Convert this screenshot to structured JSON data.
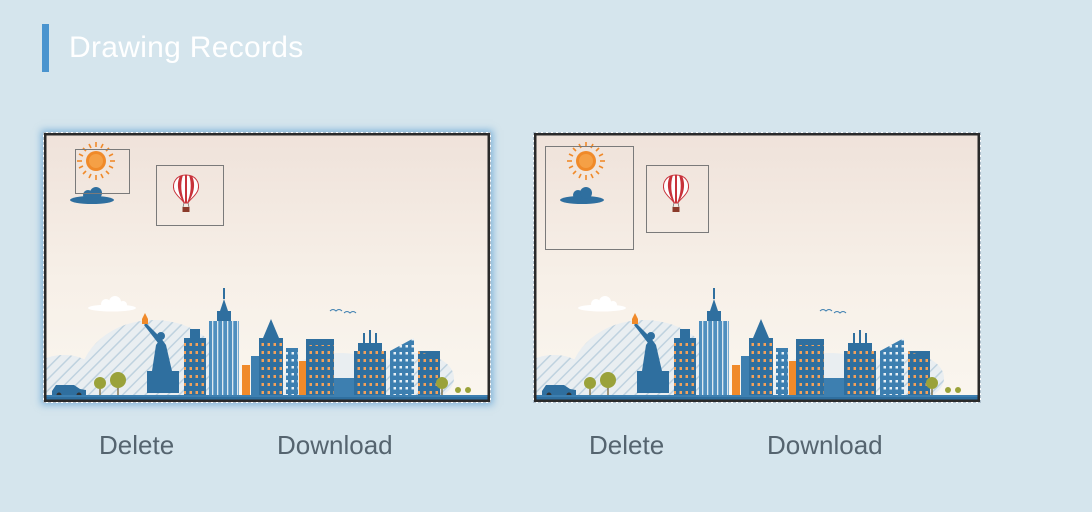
{
  "header": {
    "title": "Drawing Records"
  },
  "records": [
    {
      "delete_label": "Delete",
      "download_label": "Download"
    },
    {
      "delete_label": "Delete",
      "download_label": "Download"
    }
  ],
  "colors": {
    "accent": "#4a94cf",
    "background": "#d5e5ed",
    "action_text": "#55646f",
    "building_blue": "#2f6f9f",
    "sun_orange": "#f08a2a",
    "balloon_red": "#c8323a"
  },
  "icons": {
    "sun": "sun-icon",
    "cloud": "cloud-icon",
    "balloon": "hot-air-balloon-icon",
    "car": "car-icon",
    "birds": "birds-icon",
    "statue": "statue-of-liberty-icon"
  }
}
